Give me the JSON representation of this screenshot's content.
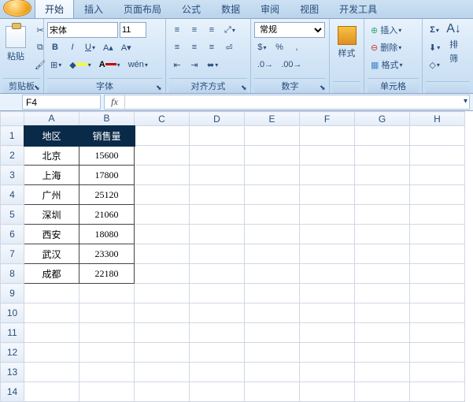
{
  "tabs": [
    "开始",
    "插入",
    "页面布局",
    "公式",
    "数据",
    "审阅",
    "视图",
    "开发工具"
  ],
  "active_tab": 0,
  "ribbon": {
    "clipboard": {
      "label": "剪贴板",
      "paste": "粘贴"
    },
    "font": {
      "label": "字体",
      "name": "宋体",
      "size": "11"
    },
    "alignment": {
      "label": "对齐方式"
    },
    "number": {
      "label": "数字",
      "format": "常规"
    },
    "styles": {
      "label": "",
      "btn": "样式"
    },
    "cells": {
      "label": "单元格",
      "insert": "插入",
      "delete": "删除",
      "format": "格式"
    },
    "editing": {
      "label": "",
      "sort": "排",
      "filter": "筛"
    }
  },
  "namebox": "F4",
  "columns": [
    "A",
    "B",
    "C",
    "D",
    "E",
    "F",
    "G",
    "H"
  ],
  "rows": [
    1,
    2,
    3,
    4,
    5,
    6,
    7,
    8,
    9,
    10,
    11,
    12,
    13,
    14
  ],
  "table": {
    "headers": [
      "地区",
      "销售量"
    ],
    "data": [
      [
        "北京",
        "15600"
      ],
      [
        "上海",
        "17800"
      ],
      [
        "广州",
        "25120"
      ],
      [
        "深圳",
        "21060"
      ],
      [
        "西安",
        "18080"
      ],
      [
        "武汉",
        "23300"
      ],
      [
        "成都",
        "22180"
      ]
    ]
  }
}
